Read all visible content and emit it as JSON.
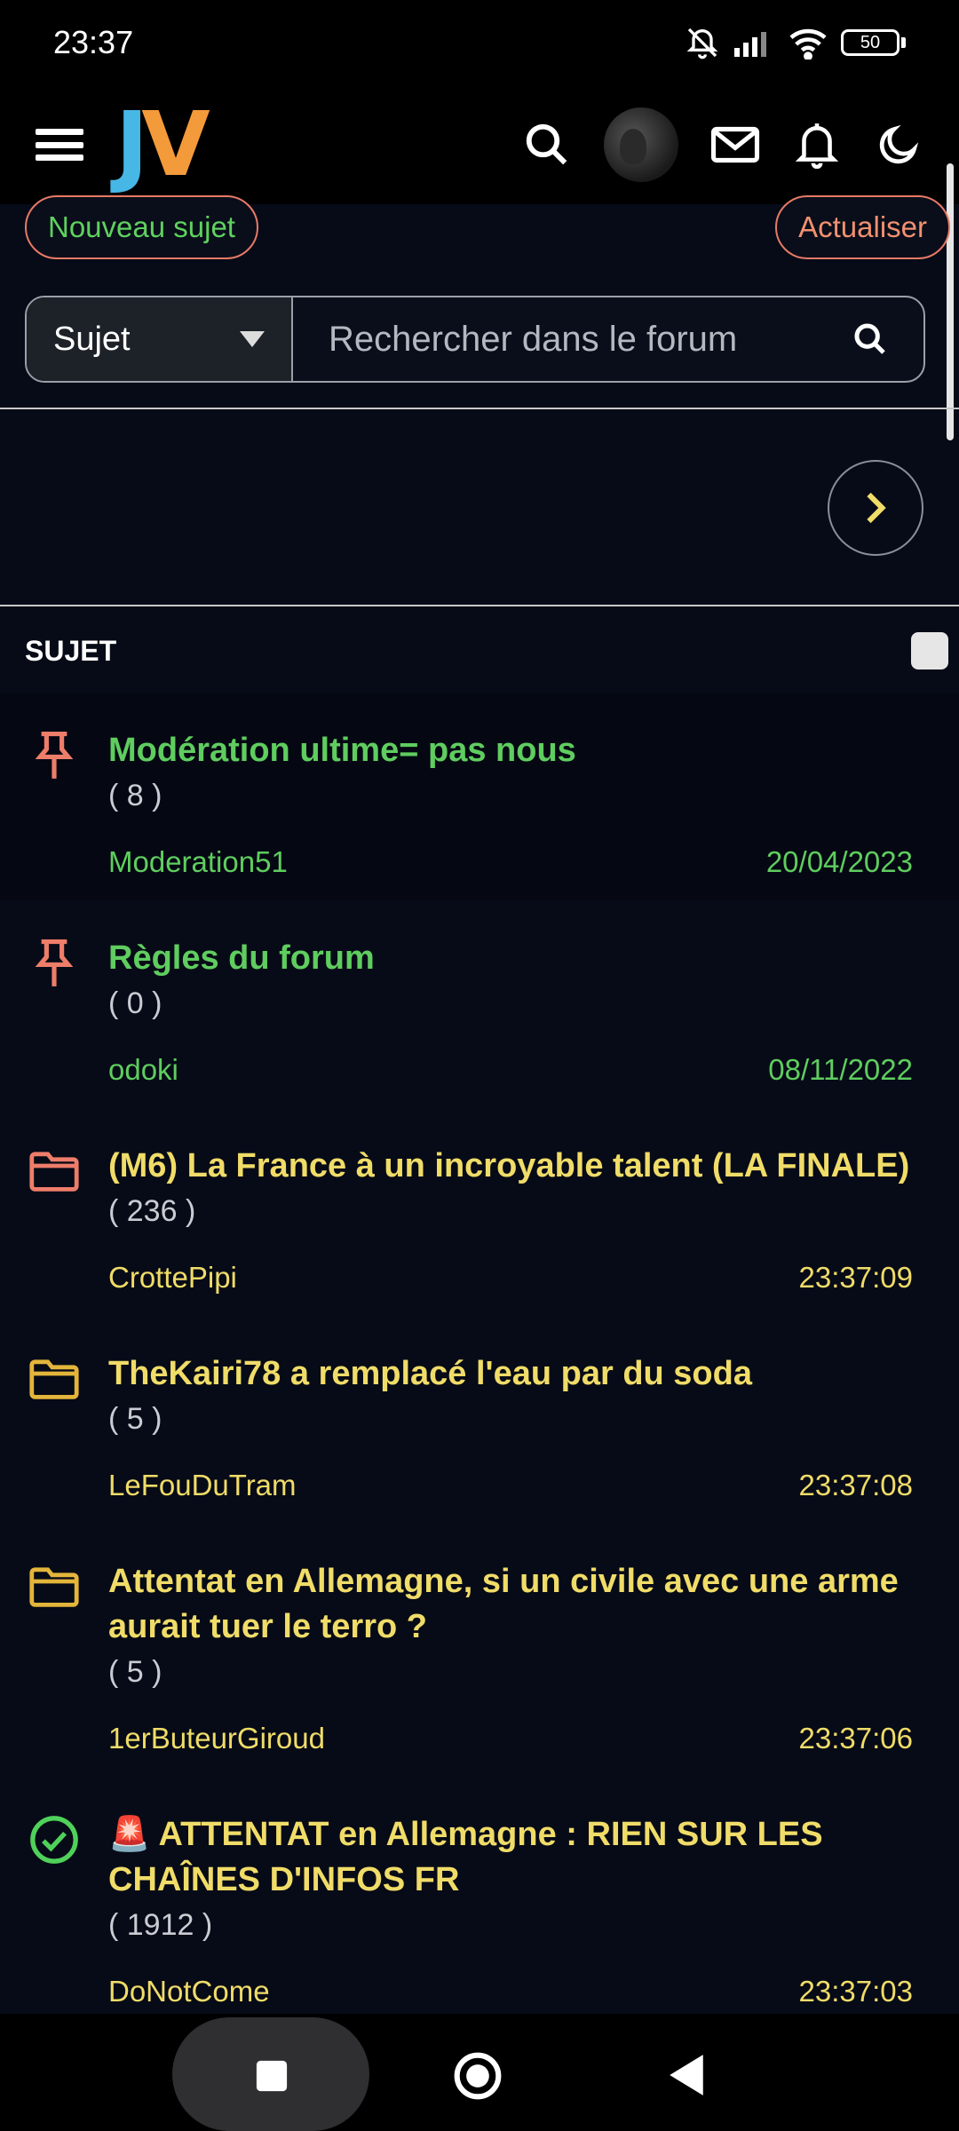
{
  "status": {
    "time": "23:37",
    "battery": "50"
  },
  "actions": {
    "new_topic": "Nouveau sujet",
    "refresh": "Actualiser"
  },
  "search": {
    "select_value": "Sujet",
    "placeholder": "Rechercher dans le forum"
  },
  "list": {
    "header": "SUJET"
  },
  "topics": [
    {
      "title": "Modération ultime= pas nous",
      "count": "( 8 )",
      "author": "Moderation51",
      "date": "20/04/2023",
      "icon": "pin-icon",
      "kind": "pinned"
    },
    {
      "title": "Règles du forum",
      "count": "( 0 )",
      "author": "odoki",
      "date": "08/11/2022",
      "icon": "pin-icon",
      "kind": "pinned"
    },
    {
      "title": "(M6) La France à un incroyable talent (LA FINALE)",
      "count": "( 236 )",
      "author": "CrottePipi",
      "date": "23:37:09",
      "icon": "folder-hot-icon",
      "kind": "normal"
    },
    {
      "title": "TheKairi78 a remplacé l'eau par du soda",
      "count": "( 5 )",
      "author": "LeFouDuTram",
      "date": "23:37:08",
      "icon": "folder-icon",
      "kind": "normal"
    },
    {
      "title": "Attentat en Allemagne, si un civile avec une arme aurait tuer le terro ?",
      "count": "( 5 )",
      "author": "1erButeurGiroud",
      "date": "23:37:06",
      "icon": "folder-icon",
      "kind": "normal"
    },
    {
      "title": "🚨 ATTENTAT en Allemagne : RIEN SUR LES CHAÎNES D'INFOS FR",
      "count": "( 1912 )",
      "author": "DoNotCome",
      "date": "23:37:03",
      "icon": "resolved-icon",
      "kind": "normal"
    }
  ],
  "colors": {
    "pinned": "#5fcd5f",
    "normal": "#f0dc68",
    "accent_orange": "#e77a66"
  }
}
